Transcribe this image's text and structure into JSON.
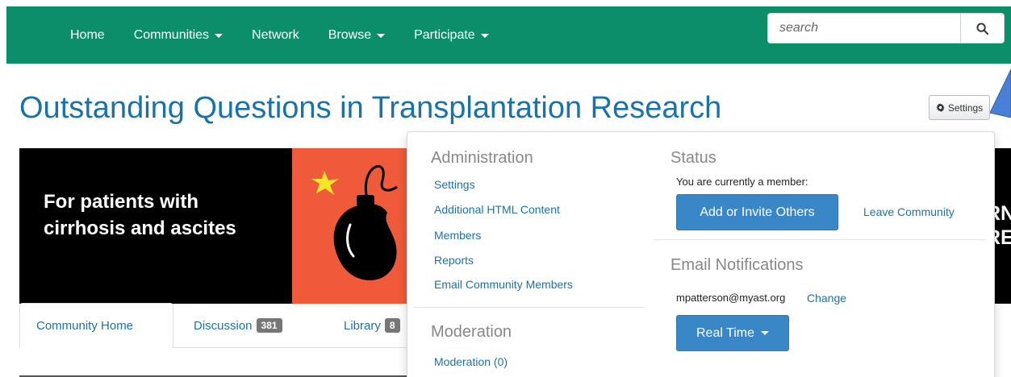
{
  "nav": {
    "items": [
      {
        "label": "Home",
        "has_caret": false
      },
      {
        "label": "Communities",
        "has_caret": true
      },
      {
        "label": "Network",
        "has_caret": false
      },
      {
        "label": "Browse",
        "has_caret": true
      },
      {
        "label": "Participate",
        "has_caret": true
      }
    ],
    "search_placeholder": "search",
    "search_icon": "search-icon"
  },
  "page": {
    "title": "Outstanding Questions in Transplantation Research",
    "settings_label": "Settings",
    "settings_icon": "gear-icon"
  },
  "banner": {
    "line1": "For patients with",
    "line2": "cirrhosis and ascites",
    "right_line1": "RN",
    "right_line2": "RE"
  },
  "tabs": [
    {
      "label": "Community Home",
      "badge": ""
    },
    {
      "label": "Discussion",
      "badge": "381"
    },
    {
      "label": "Library",
      "badge": "8"
    }
  ],
  "dropdown": {
    "administration": {
      "heading": "Administration",
      "links": [
        "Settings",
        "Additional HTML Content",
        "Members",
        "Reports",
        "Email Community Members"
      ]
    },
    "moderation": {
      "heading": "Moderation",
      "links": [
        "Moderation (0)"
      ]
    },
    "status": {
      "heading": "Status",
      "text": "You are currently a member:",
      "invite_label": "Add or Invite Others",
      "leave_label": "Leave Community"
    },
    "email": {
      "heading": "Email Notifications",
      "address": "mpatterson@myast.org",
      "change_label": "Change",
      "frequency_label": "Real Time"
    }
  },
  "colors": {
    "nav_bg": "#0b8f6a",
    "link": "#1a73a8",
    "button": "#3a87c8",
    "badge": "#777777",
    "banner_accent": "#ef5a3a"
  }
}
